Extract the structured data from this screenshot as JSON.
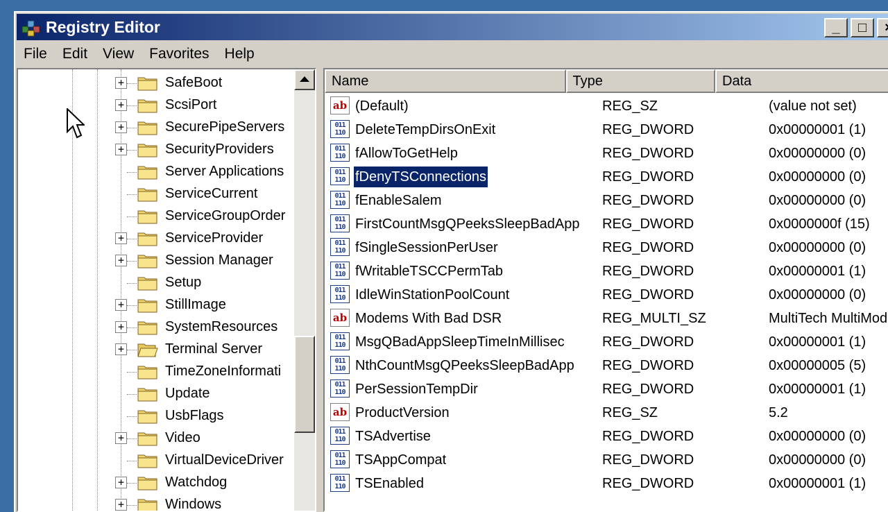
{
  "window": {
    "title": "Registry Editor"
  },
  "title_buttons": {
    "minimize": "_",
    "maximize": "□",
    "close": "×"
  },
  "menu": [
    {
      "label": "File"
    },
    {
      "label": "Edit"
    },
    {
      "label": "View"
    },
    {
      "label": "Favorites"
    },
    {
      "label": "Help"
    }
  ],
  "tree": [
    {
      "label": "SafeBoot",
      "expandable": true,
      "symbol": "+"
    },
    {
      "label": "ScsiPort",
      "expandable": true,
      "symbol": "+"
    },
    {
      "label": "SecurePipeServers",
      "expandable": true,
      "symbol": "+"
    },
    {
      "label": "SecurityProviders",
      "expandable": true,
      "symbol": "+"
    },
    {
      "label": "Server Applications",
      "expandable": false,
      "symbol": ""
    },
    {
      "label": "ServiceCurrent",
      "expandable": false,
      "symbol": ""
    },
    {
      "label": "ServiceGroupOrder",
      "expandable": false,
      "symbol": ""
    },
    {
      "label": "ServiceProvider",
      "expandable": true,
      "symbol": "+"
    },
    {
      "label": "Session Manager",
      "expandable": true,
      "symbol": "+"
    },
    {
      "label": "Setup",
      "expandable": false,
      "symbol": ""
    },
    {
      "label": "StillImage",
      "expandable": true,
      "symbol": "+"
    },
    {
      "label": "SystemResources",
      "expandable": true,
      "symbol": "+"
    },
    {
      "label": "Terminal Server",
      "expandable": true,
      "symbol": "+",
      "open": true
    },
    {
      "label": "TimeZoneInformati",
      "expandable": false,
      "symbol": ""
    },
    {
      "label": "Update",
      "expandable": false,
      "symbol": ""
    },
    {
      "label": "UsbFlags",
      "expandable": false,
      "symbol": ""
    },
    {
      "label": "Video",
      "expandable": true,
      "symbol": "+"
    },
    {
      "label": "VirtualDeviceDriver",
      "expandable": false,
      "symbol": ""
    },
    {
      "label": "Watchdog",
      "expandable": true,
      "symbol": "+"
    },
    {
      "label": "Windows",
      "expandable": true,
      "symbol": "+"
    }
  ],
  "columns": {
    "name": "Name",
    "type": "Type",
    "data": "Data"
  },
  "icon_text": {
    "string": "ab",
    "binary": "011\n110\n010"
  },
  "values": [
    {
      "icon": "string",
      "name": "(Default)",
      "type": "REG_SZ",
      "data": "(value not set)"
    },
    {
      "icon": "dword",
      "name": "DeleteTempDirsOnExit",
      "type": "REG_DWORD",
      "data": "0x00000001 (1)"
    },
    {
      "icon": "dword",
      "name": "fAllowToGetHelp",
      "type": "REG_DWORD",
      "data": "0x00000000 (0)"
    },
    {
      "icon": "dword",
      "name": "fDenyTSConnections",
      "type": "REG_DWORD",
      "data": "0x00000000 (0)",
      "selected": true
    },
    {
      "icon": "dword",
      "name": "fEnableSalem",
      "type": "REG_DWORD",
      "data": "0x00000000 (0)"
    },
    {
      "icon": "dword",
      "name": "FirstCountMsgQPeeksSleepBadApp",
      "type": "REG_DWORD",
      "data": "0x0000000f (15)"
    },
    {
      "icon": "dword",
      "name": "fSingleSessionPerUser",
      "type": "REG_DWORD",
      "data": "0x00000000 (0)"
    },
    {
      "icon": "dword",
      "name": "fWritableTSCCPermTab",
      "type": "REG_DWORD",
      "data": "0x00000001 (1)"
    },
    {
      "icon": "dword",
      "name": "IdleWinStationPoolCount",
      "type": "REG_DWORD",
      "data": "0x00000000 (0)"
    },
    {
      "icon": "string",
      "name": "Modems With Bad DSR",
      "type": "REG_MULTI_SZ",
      "data": "MultiTech MultiMod"
    },
    {
      "icon": "dword",
      "name": "MsgQBadAppSleepTimeInMillisec",
      "type": "REG_DWORD",
      "data": "0x00000001 (1)"
    },
    {
      "icon": "dword",
      "name": "NthCountMsgQPeeksSleepBadApp",
      "type": "REG_DWORD",
      "data": "0x00000005 (5)"
    },
    {
      "icon": "dword",
      "name": "PerSessionTempDir",
      "type": "REG_DWORD",
      "data": "0x00000001 (1)"
    },
    {
      "icon": "string",
      "name": "ProductVersion",
      "type": "REG_SZ",
      "data": "5.2"
    },
    {
      "icon": "dword",
      "name": "TSAdvertise",
      "type": "REG_DWORD",
      "data": "0x00000000 (0)"
    },
    {
      "icon": "dword",
      "name": "TSAppCompat",
      "type": "REG_DWORD",
      "data": "0x00000000 (0)"
    },
    {
      "icon": "dword",
      "name": "TSEnabled",
      "type": "REG_DWORD",
      "data": "0x00000001 (1)"
    }
  ],
  "colors": {
    "selection": "#0a246a",
    "title_start": "#0a246a",
    "title_end": "#a6caf0",
    "desktop": "#3a6ea5"
  }
}
